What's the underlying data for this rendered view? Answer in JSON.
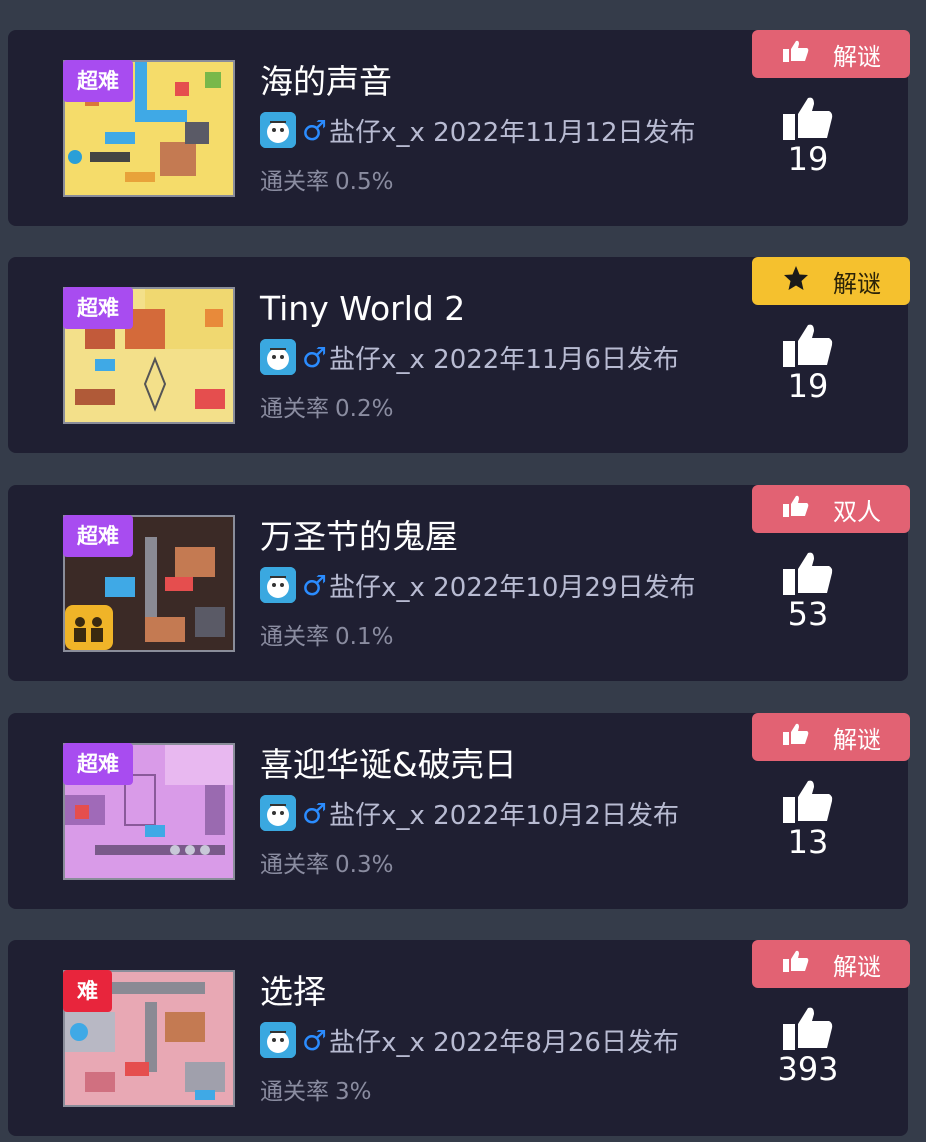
{
  "levels": [
    {
      "difficulty": "超难",
      "difficulty_color": "#a84cf0",
      "title": "海的声音",
      "author": "盐仔x_x 2022年11月12日发布",
      "gender_symbol": "♂",
      "pass_label": "通关率",
      "pass_rate": "0.5%",
      "category": "解谜",
      "category_icon": "thumb-up-icon",
      "category_color": "#e26273",
      "likes": "19"
    },
    {
      "difficulty": "超难",
      "difficulty_color": "#a84cf0",
      "title": "Tiny World 2",
      "author": "盐仔x_x 2022年11月6日发布",
      "gender_symbol": "♂",
      "pass_label": "通关率",
      "pass_rate": "0.2%",
      "category": "解谜",
      "category_icon": "star-icon",
      "category_color": "#f5c12e",
      "likes": "19"
    },
    {
      "difficulty": "超难",
      "difficulty_color": "#a84cf0",
      "title": "万圣节的鬼屋",
      "author": "盐仔x_x 2022年10月29日发布",
      "gender_symbol": "♂",
      "pass_label": "通关率",
      "pass_rate": "0.1%",
      "category": "双人",
      "category_icon": "thumb-up-icon",
      "category_color": "#e26273",
      "likes": "53"
    },
    {
      "difficulty": "超难",
      "difficulty_color": "#a84cf0",
      "title": "喜迎华诞&破壳日",
      "author": "盐仔x_x 2022年10月2日发布",
      "gender_symbol": "♂",
      "pass_label": "通关率",
      "pass_rate": "0.3%",
      "category": "解谜",
      "category_icon": "thumb-up-icon",
      "category_color": "#e26273",
      "likes": "13"
    },
    {
      "difficulty": "难",
      "difficulty_color": "#e8253c",
      "title": "选择",
      "author": "盐仔x_x 2022年8月26日发布",
      "gender_symbol": "♂",
      "pass_label": "通关率",
      "pass_rate": "3%",
      "category": "解谜",
      "category_icon": "thumb-up-icon",
      "category_color": "#e26273",
      "likes": "393"
    }
  ]
}
